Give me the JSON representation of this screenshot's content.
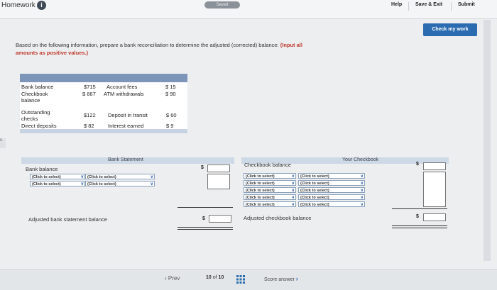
{
  "header": {
    "title": "Homework",
    "info_glyph": "i",
    "saved_label": "Saved",
    "help_label": "Help",
    "save_exit_label": "Save & Exit",
    "submit_label": "Submit",
    "check_work_label": "Check my work"
  },
  "instructions": {
    "text": "Based on the following information, prepare a bank reconciliation to determine the adjusted (corrected) balance:",
    "emphasis": "(Input all amounts as positive values.)"
  },
  "info_table": {
    "rows": [
      {
        "label": "Bank balance",
        "value": "$715",
        "label2": "Account fees",
        "value2": "$ 15"
      },
      {
        "label": "Checkbook balance",
        "value": "$ 667",
        "label2": "ATM withdrawals",
        "value2": "$ 90"
      },
      {
        "label": "Outstanding checks",
        "value": "$122",
        "label2": "Deposit in transit",
        "value2": "$ 60"
      },
      {
        "label": "Direct deposits",
        "value": "$ 82",
        "label2": "Interest earned",
        "value2": "$ 9"
      }
    ]
  },
  "bank_statement": {
    "title": "Bank Statement",
    "balance_label": "Bank balance",
    "currency": "$",
    "selects": [
      "(Click to select)",
      "(Click to select)",
      "(Click to select)",
      "(Click to select)"
    ],
    "adjusted_label": "Adjusted bank statement balance"
  },
  "checkbook": {
    "title": "Your Checkbook",
    "balance_label": "Checkbook balance",
    "currency": "$",
    "selects": [
      "(Click to select)",
      "(Click to select)",
      "(Click to select)",
      "(Click to select)",
      "(Click to select)",
      "(Click to select)",
      "(Click to select)",
      "(Click to select)",
      "(Click to select)",
      "(Click to select)"
    ],
    "adjusted_label": "Adjusted checkbook balance"
  },
  "left_edge_text": "s",
  "pager": {
    "prev_label": "Prev",
    "current": "10",
    "of_label": "of",
    "total": "10",
    "next_label": "Score answer"
  },
  "colors": {
    "accent": "#2b6cb0",
    "table_header": "#7c95b8"
  }
}
